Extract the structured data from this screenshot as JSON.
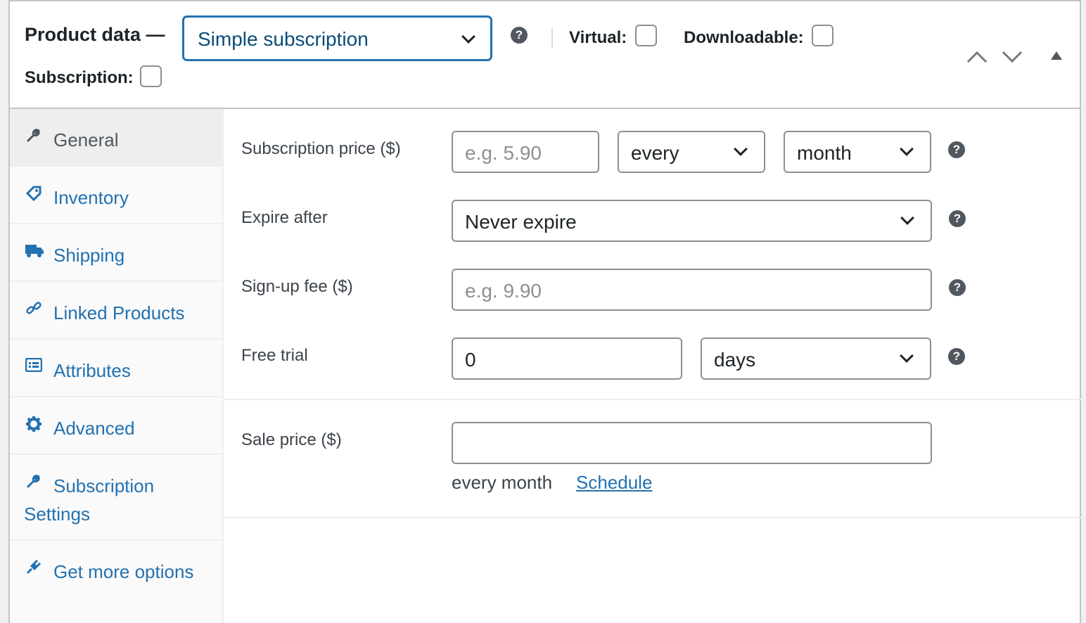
{
  "header": {
    "title": "Product data —",
    "product_type": "Simple subscription",
    "virtual_label": "Virtual:",
    "downloadable_label": "Downloadable:",
    "subscription_label": "Subscription:"
  },
  "sidebar": {
    "items": [
      {
        "label": "General",
        "icon": "wrench-icon",
        "active": true
      },
      {
        "label": "Inventory",
        "icon": "tag-icon"
      },
      {
        "label": "Shipping",
        "icon": "truck-icon"
      },
      {
        "label": "Linked Products",
        "icon": "link-icon"
      },
      {
        "label": "Attributes",
        "icon": "list-icon"
      },
      {
        "label": "Advanced",
        "icon": "gear-icon"
      },
      {
        "label": "Subscription Settings",
        "icon": "wrench-icon"
      },
      {
        "label": "Get more options",
        "icon": "plugin-icon"
      }
    ]
  },
  "form": {
    "subscription_price_label": "Subscription price ($)",
    "subscription_price_placeholder": "e.g. 5.90",
    "interval_value": "every",
    "period_value": "month",
    "expire_label": "Expire after",
    "expire_value": "Never expire",
    "signup_label": "Sign-up fee ($)",
    "signup_placeholder": "e.g. 9.90",
    "trial_label": "Free trial",
    "trial_value": "0",
    "trial_period": "days",
    "sale_label": "Sale price ($)",
    "sale_value": "",
    "sale_suffix": "every month",
    "schedule_link": "Schedule"
  },
  "help_glyph": "?",
  "colors": {
    "accent": "#2271b1",
    "select_text": "#0a4b78",
    "border": "#8c8f94"
  }
}
